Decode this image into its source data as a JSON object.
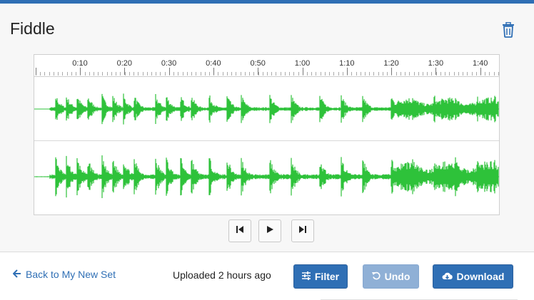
{
  "title": "Fiddle",
  "timeline": {
    "labels": [
      "0:10",
      "0:20",
      "0:30",
      "0:40",
      "0:50",
      "1:00",
      "1:10",
      "1:20",
      "1:30",
      "1:40"
    ]
  },
  "waveform_color": "#2ec23a",
  "accent_color": "#2f6fb5",
  "icons": {
    "delete": "trash-icon",
    "skip_back": "skip-back-icon",
    "play": "play-icon",
    "skip_forward": "skip-forward-icon",
    "back": "arrow-left-icon",
    "filter": "sliders-icon",
    "undo": "undo-icon",
    "download": "cloud-download-icon"
  },
  "footer": {
    "back_label": "Back to My New Set",
    "uploaded_text": "Uploaded 2 hours ago",
    "filter_label": "Filter",
    "undo_label": "Undo",
    "download_label": "Download"
  }
}
